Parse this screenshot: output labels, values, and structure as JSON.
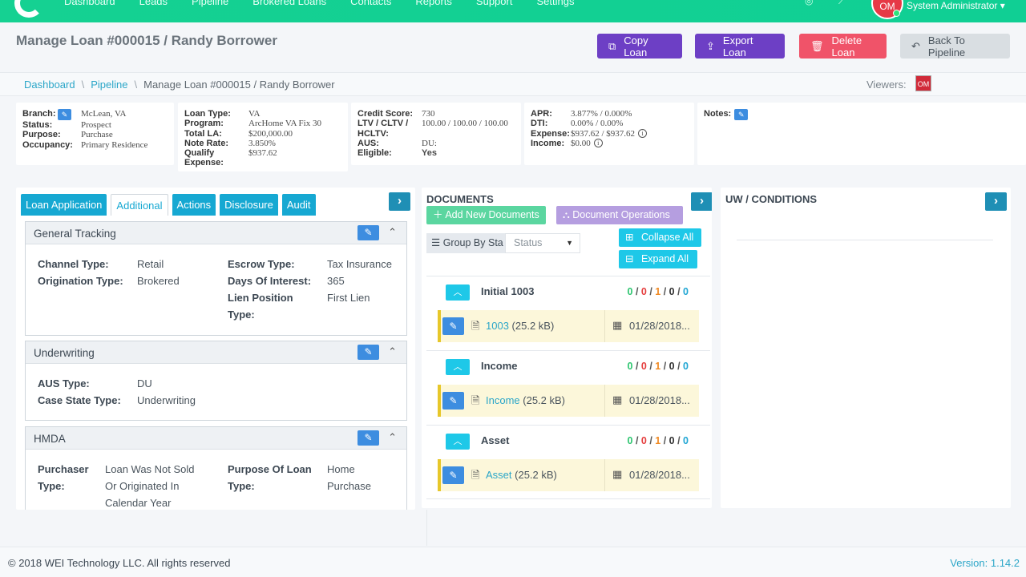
{
  "nav": {
    "items": [
      "Dashboard",
      "Leads",
      "Pipeline",
      "Brokered Loans",
      "Contacts",
      "Reports",
      "Support",
      "Settings"
    ],
    "user_name": "System Administrator",
    "avatar_initials": "OM"
  },
  "header": {
    "title": "Manage Loan #000015 / Randy Borrower",
    "copy_label": "Copy Loan",
    "export_label": "Export Loan",
    "delete_label": "Delete Loan",
    "back_label": "Back To Pipeline"
  },
  "breadcrumb": {
    "items": [
      "Dashboard",
      "Pipeline",
      "Manage Loan #000015 / Randy Borrower"
    ],
    "viewers_label": "Viewers:",
    "viewer_initials": "OM"
  },
  "summary": {
    "card1": [
      {
        "k": "Branch:",
        "v": "McLean, VA"
      },
      {
        "k": "Status:",
        "v": "Prospect"
      },
      {
        "k": "Purpose:",
        "v": "Purchase"
      },
      {
        "k": "Occupancy:",
        "v": "Primary Residence"
      }
    ],
    "card2": [
      {
        "k": "Loan Type:",
        "v": "VA"
      },
      {
        "k": "Program:",
        "v": "ArcHome VA Fix 30"
      },
      {
        "k": "Total LA:",
        "v": "$200,000.00"
      },
      {
        "k": "Note Rate:",
        "v": "3.850%"
      },
      {
        "k": "Qualify",
        "v": "$937.62"
      },
      {
        "k": "Expense:",
        "v": ""
      }
    ],
    "card3": [
      {
        "k": "Credit Score:",
        "v": "730"
      },
      {
        "k": "LTV / CLTV /",
        "v": "100.00 / 100.00 / 100.00"
      },
      {
        "k": "HCLTV:",
        "v": ""
      },
      {
        "k": "AUS:",
        "v": "DU:"
      },
      {
        "k": "Eligible:",
        "v": "Yes"
      }
    ],
    "card4": [
      {
        "k": "APR:",
        "v": "3.877% / 0.000%"
      },
      {
        "k": "DTI:",
        "v": "0.00% / 0.00%"
      },
      {
        "k": "Expense:",
        "v": "$937.62 / $937.62"
      },
      {
        "k": "Income:",
        "v": "$0.00"
      }
    ],
    "notes_label": "Notes:"
  },
  "left_panel": {
    "tabs": [
      "Loan Application",
      "Additional",
      "Actions",
      "Disclosure",
      "Audit"
    ],
    "sections": {
      "general": {
        "title": "General Tracking",
        "channel_k": "Channel Type:",
        "channel_v": "Retail",
        "origination_k": "Origination Type:",
        "origination_v": "Brokered",
        "escrow_k": "Escrow Type:",
        "escrow_v": "Tax Insurance",
        "days_k": "Days Of Interest:",
        "days_v": "365",
        "lien_k1": "Lien Position",
        "lien_k2": "Type:",
        "lien_v": "First Lien"
      },
      "underwriting": {
        "title": "Underwriting",
        "aus_k": "AUS Type:",
        "aus_v": "DU",
        "case_k": "Case State Type:",
        "case_v": "Underwriting"
      },
      "hmda": {
        "title": "HMDA",
        "purchaser_k1": "Purchaser",
        "purchaser_k2": "Type:",
        "purchaser_v1": "Loan Was Not Sold",
        "purchaser_v2": "Or Originated In",
        "purchaser_v3": "Calendar Year",
        "purpose_k1": "Purpose Of Loan",
        "purpose_k2": "Type:",
        "purpose_v1": "Home",
        "purpose_v2": "Purchase"
      }
    }
  },
  "documents": {
    "title": "DOCUMENTS",
    "add_label": "Add New Documents",
    "ops_label": "Document Operations",
    "group_label": "Group By Sta",
    "status_placeholder": "Status",
    "collapse_label": "Collapse All",
    "expand_label": "Expand All",
    "groups": [
      {
        "name": "Initial 1003",
        "counts": [
          "0",
          "0",
          "1",
          "0",
          "0"
        ],
        "file": "1003",
        "size": "(25.2 kB)",
        "date": "01/28/2018..."
      },
      {
        "name": "Income",
        "counts": [
          "0",
          "0",
          "1",
          "0",
          "0"
        ],
        "file": "Income",
        "size": "(25.2 kB)",
        "date": "01/28/2018..."
      },
      {
        "name": "Asset",
        "counts": [
          "0",
          "0",
          "1",
          "0",
          "0"
        ],
        "file": "Asset",
        "size": "(25.2 kB)",
        "date": "01/28/2018..."
      }
    ]
  },
  "uw": {
    "title": "UW / CONDITIONS"
  },
  "footer": {
    "copyright": "© 2018 WEI Technology LLC. All rights reserved",
    "version": "Version: 1.14.2"
  },
  "colors": {
    "nav_green": "#15d192",
    "accent_purple": "#6d3fc5",
    "delete_red": "#f05369",
    "link_teal": "#2ba6c8"
  }
}
